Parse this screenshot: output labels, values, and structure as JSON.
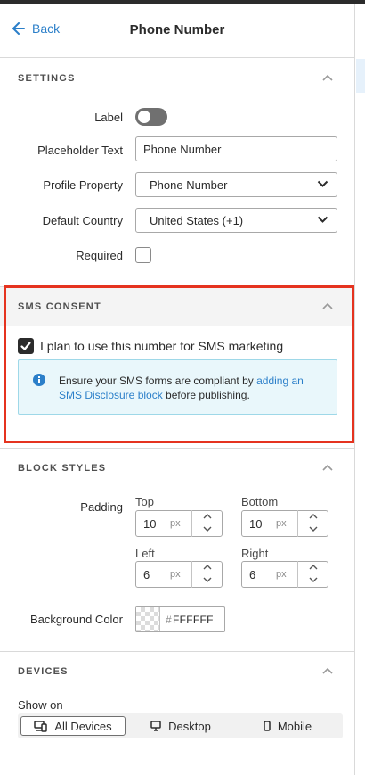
{
  "header": {
    "back_label": "Back",
    "title": "Phone Number"
  },
  "settings": {
    "section_title": "SETTINGS",
    "label_label": "Label",
    "label_toggle_on": false,
    "placeholder_label": "Placeholder Text",
    "placeholder_value": "Phone Number",
    "profile_label": "Profile Property",
    "profile_value": "Phone Number",
    "country_label": "Default Country",
    "country_value": "United States (+1)",
    "required_label": "Required",
    "required_checked": false
  },
  "sms": {
    "section_title": "SMS CONSENT",
    "checkbox_label": "I plan to use this number for SMS marketing",
    "checkbox_checked": true,
    "info_prefix": "Ensure your SMS forms are compliant by ",
    "info_link": "adding an SMS Disclosure block",
    "info_suffix": " before publishing."
  },
  "block_styles": {
    "section_title": "BLOCK STYLES",
    "padding_label": "Padding",
    "top_label": "Top",
    "top_value": "10",
    "bottom_label": "Bottom",
    "bottom_value": "10",
    "left_label": "Left",
    "left_value": "6",
    "right_label": "Right",
    "right_value": "6",
    "unit": "px",
    "bg_label": "Background Color",
    "bg_hash": "#",
    "bg_value": "FFFFFF"
  },
  "devices": {
    "section_title": "DEVICES",
    "show_on_label": "Show on",
    "options": [
      {
        "label": "All Devices",
        "active": true
      },
      {
        "label": "Desktop",
        "active": false
      },
      {
        "label": "Mobile",
        "active": false
      }
    ]
  },
  "colors": {
    "accent": "#2b7fc9",
    "highlight_border": "#e5331f",
    "info_bg": "#e9f7fb",
    "info_border": "#9ed8e8"
  },
  "icons": {
    "back": "arrow-left-icon",
    "collapse": "chevron-up-icon",
    "dropdown": "chevron-down-icon",
    "info": "info-circle-icon",
    "all_devices": "devices-icon",
    "desktop": "monitor-icon",
    "mobile": "phone-icon"
  }
}
